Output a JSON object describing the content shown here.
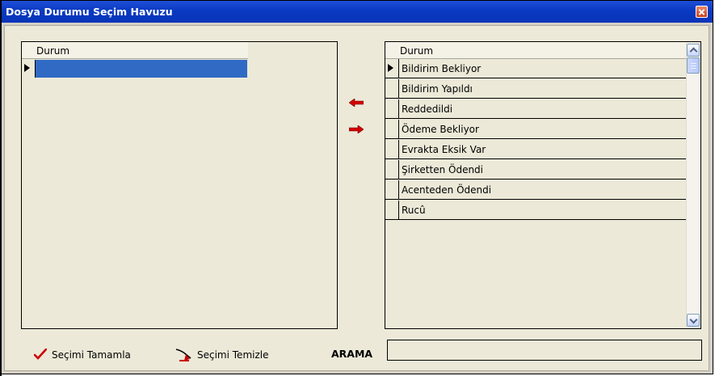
{
  "window": {
    "title": "Dosya Durumu Seçim Havuzu"
  },
  "left_grid": {
    "header": "Durum",
    "rows": [
      ""
    ]
  },
  "right_grid": {
    "header": "Durum",
    "rows": [
      "Bildirim Bekliyor",
      "Bildirim Yapıldı",
      "Reddedildi",
      "Ödeme Bekliyor",
      "Evrakta Eksik Var",
      "Şirketten Ödendi",
      "Acenteden Ödendi",
      "Rucû"
    ]
  },
  "transfer": {
    "move_left_icon": "red-left-arrow-icon",
    "move_right_icon": "red-right-arrow-icon"
  },
  "footer": {
    "complete_label": "Seçimi Tamamla",
    "clear_label": "Seçimi Temizle",
    "search_label": "ARAMA",
    "search_value": ""
  },
  "colors": {
    "title_bar": "#0a3ac2",
    "selection": "#316ac5",
    "arrow": "#d40000",
    "check": "#cc0000"
  }
}
